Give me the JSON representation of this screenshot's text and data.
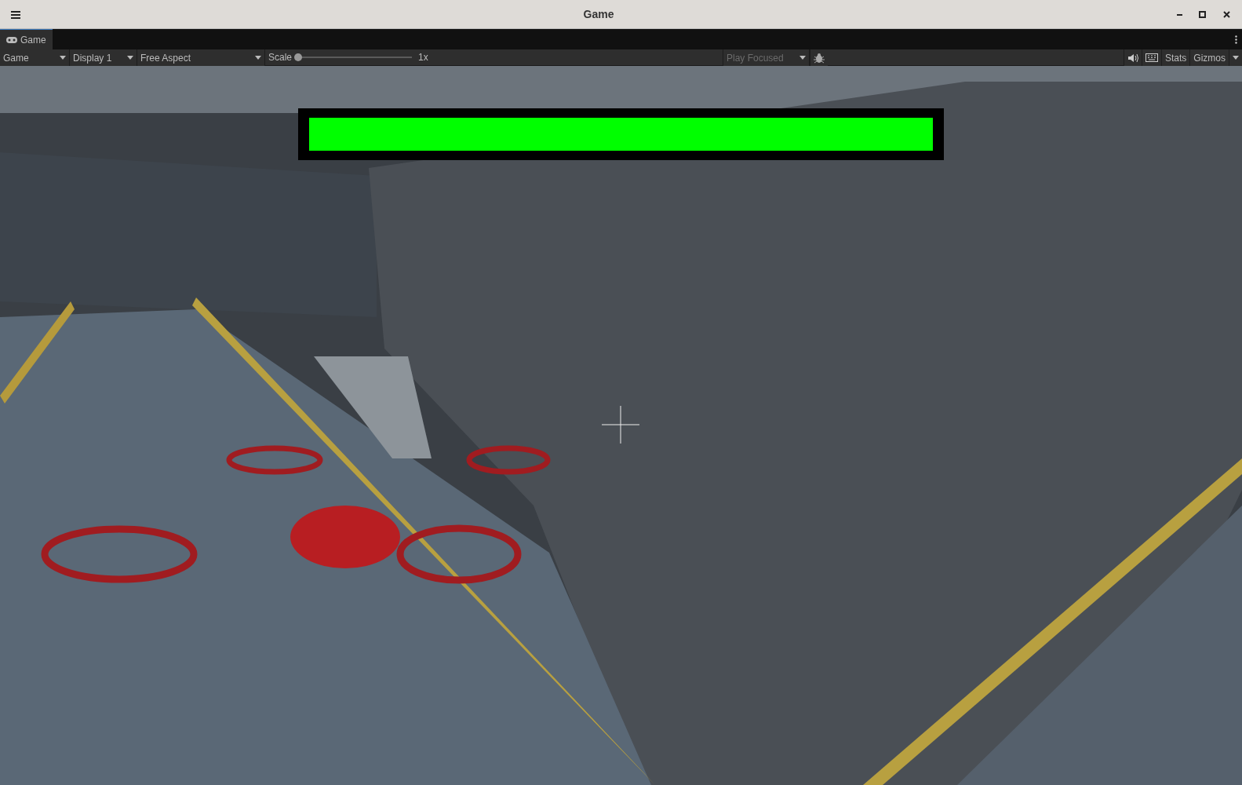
{
  "window": {
    "title": "Game"
  },
  "tabs": [
    {
      "label": "Game",
      "selected": true
    }
  ],
  "toolbar": {
    "view_dropdown": "Game",
    "display_dropdown": "Display 1",
    "aspect_dropdown": "Free Aspect",
    "scale_label": "Scale",
    "scale": {
      "level": 0
    },
    "scale_reading": "1x",
    "play_mode_dropdown": "Play Focused",
    "play_mode_disabled": true,
    "stats": "Stats",
    "gizmos": "Gizmos"
  },
  "game_view": {
    "kind": "picture",
    "health_bar": {
      "level": 1
    }
  }
}
